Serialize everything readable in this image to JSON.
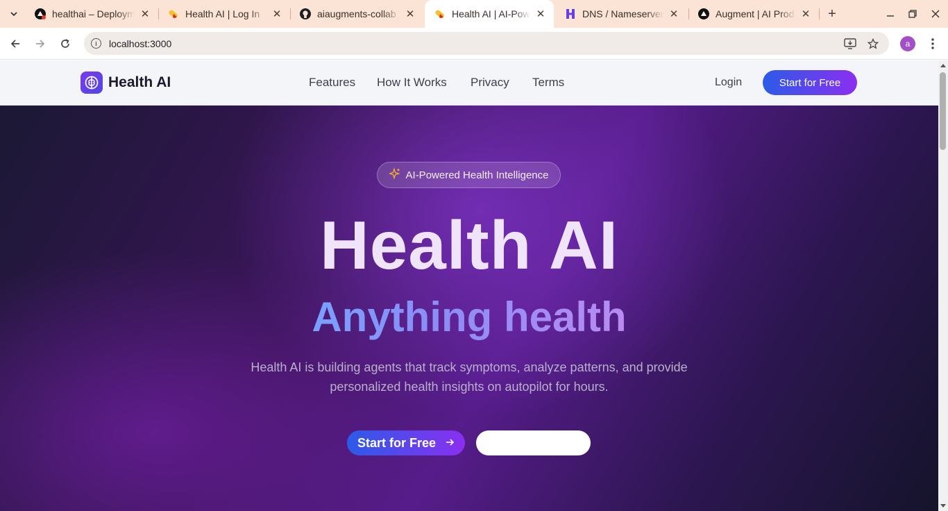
{
  "browser": {
    "tabs": [
      {
        "title": "healthai – Deployments",
        "favicon": "vercel-icon",
        "active": false
      },
      {
        "title": "Health AI | Log In",
        "favicon": "pill-icon",
        "active": false
      },
      {
        "title": "aiaugments-collab",
        "favicon": "github-icon",
        "active": false
      },
      {
        "title": "Health AI | AI-Powered",
        "favicon": "pill-icon",
        "active": true
      },
      {
        "title": "DNS / Nameservers",
        "favicon": "hostinger-icon",
        "active": false
      },
      {
        "title": "Augment | AI Product",
        "favicon": "vercel-icon",
        "active": false
      }
    ],
    "close_glyph": "✕",
    "new_tab_glyph": "+",
    "url": "localhost:3000",
    "profile_initial": "a"
  },
  "site": {
    "brand": "Health AI",
    "nav": {
      "features": "Features",
      "how_it_works": "How It Works",
      "privacy": "Privacy",
      "terms": "Terms"
    },
    "login": "Login",
    "header_cta": "Start for Free"
  },
  "hero": {
    "badge": "AI-Powered Health Intelligence",
    "title": "Health AI",
    "subtitle": "Anything health",
    "description": "Health AI is building agents that track symptoms, analyze patterns, and provide personalized health insights on autopilot for hours.",
    "primary_cta": "Start for Free",
    "secondary_cta": ""
  },
  "colors": {
    "accent_start": "#2c5be8",
    "accent_end": "#8b2ff0",
    "hero_bg": "#3a1558",
    "tabstrip_bg": "#fbe3d6"
  }
}
